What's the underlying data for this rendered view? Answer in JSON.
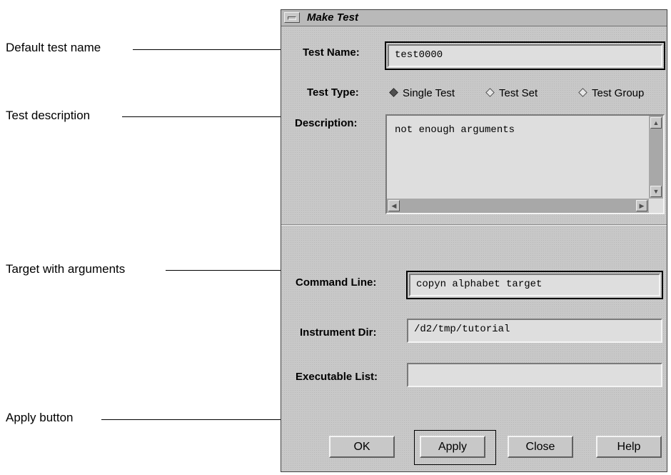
{
  "callouts": {
    "default_test_name": "Default test name",
    "test_description": "Test description",
    "target_with_arguments": "Target with arguments",
    "apply_button": "Apply button"
  },
  "window": {
    "title": "Make Test",
    "test_name": {
      "label": "Test Name:",
      "value": "test0000"
    },
    "test_type": {
      "label": "Test Type:",
      "options": [
        "Single Test",
        "Test Set",
        "Test Group"
      ],
      "selected": "Single Test"
    },
    "description": {
      "label": "Description:",
      "value": "not enough arguments"
    },
    "command_line": {
      "label": "Command Line:",
      "value": "copyn alphabet target"
    },
    "instrument_dir": {
      "label": "Instrument Dir:",
      "value": "/d2/tmp/tutorial"
    },
    "executable_list": {
      "label": "Executable List:",
      "value": ""
    },
    "buttons": {
      "ok": "OK",
      "apply": "Apply",
      "close": "Close",
      "help": "Help"
    }
  }
}
